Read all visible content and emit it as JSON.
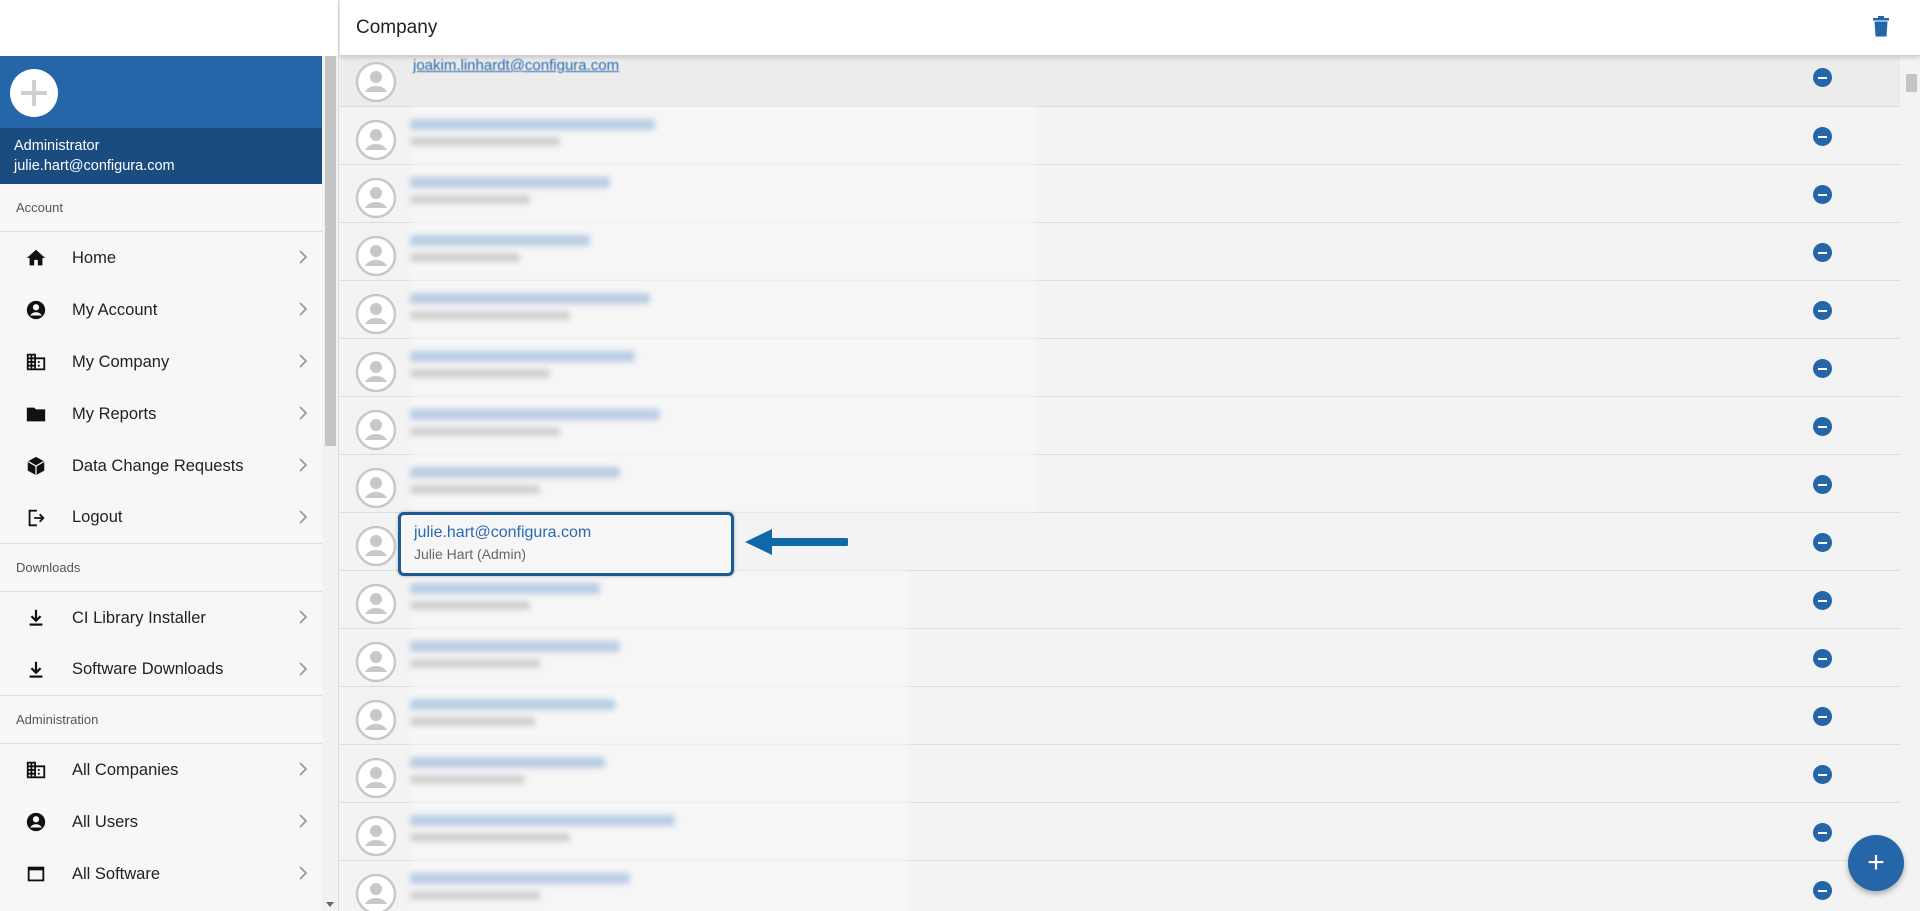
{
  "header": {
    "title": "Company"
  },
  "user": {
    "role": "Administrator",
    "email": "julie.hart@configura.com"
  },
  "sidebar": {
    "sections": [
      {
        "label": "Account",
        "items": [
          {
            "label": "Home",
            "icon": "home-icon"
          },
          {
            "label": "My Account",
            "icon": "account-circle-icon"
          },
          {
            "label": "My Company",
            "icon": "building-icon"
          },
          {
            "label": "My Reports",
            "icon": "folder-icon"
          },
          {
            "label": "Data Change Requests",
            "icon": "cube-icon"
          },
          {
            "label": "Logout",
            "icon": "logout-icon"
          }
        ]
      },
      {
        "label": "Downloads",
        "items": [
          {
            "label": "CI Library Installer",
            "icon": "download-icon"
          },
          {
            "label": "Software Downloads",
            "icon": "download-icon"
          }
        ]
      },
      {
        "label": "Administration",
        "items": [
          {
            "label": "All Companies",
            "icon": "building-icon"
          },
          {
            "label": "All Users",
            "icon": "account-circle-icon"
          },
          {
            "label": "All Software",
            "icon": "window-icon"
          }
        ]
      }
    ]
  },
  "list": {
    "first_email": "joakim.linhardt@configura.com",
    "highlighted": {
      "email": "julie.hart@configura.com",
      "name": "Julie Hart (Admin)"
    }
  },
  "colors": {
    "accent": "#2566a8",
    "header_dark": "#1b4c80",
    "link": "#2a6ab0"
  },
  "fab_label": "+"
}
